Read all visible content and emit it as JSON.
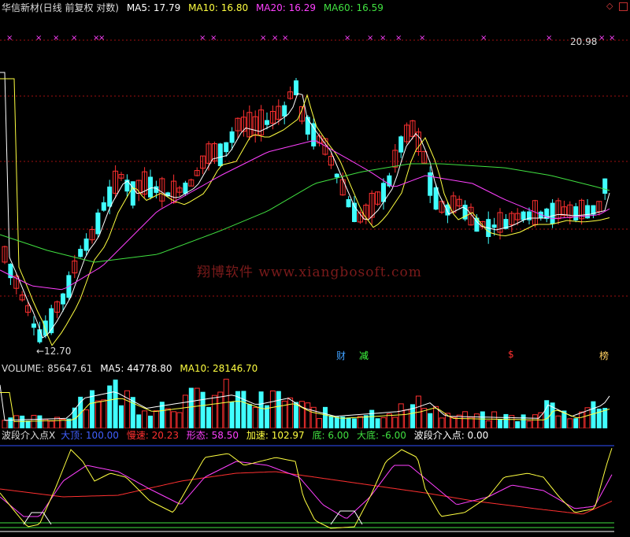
{
  "header": {
    "title": "华信新材(日线 前复权 对数)",
    "ma5": "MA5: 17.79",
    "ma10": "MA10: 16.80",
    "ma20": "MA20: 16.29",
    "ma60": "MA60: 16.59"
  },
  "price_panel": {
    "high_label": "20.98",
    "low_label": "←12.70",
    "watermark": "翔博软件 www.xiangbosoft.com",
    "tags": [
      {
        "text": "财",
        "color": "#40a0ff"
      },
      {
        "text": "减",
        "color": "#40ff40"
      },
      {
        "text": "$",
        "color": "#ff3030"
      },
      {
        "text": "榜",
        "color": "#ffd060"
      }
    ]
  },
  "volume_panel": {
    "label": "VOLUME: 85647.61",
    "ma5": "MA5: 44778.80",
    "ma10": "MA10: 28146.70"
  },
  "indicator_panel": {
    "name": "波段介入点X",
    "dading": "大顶: 100.00",
    "mansu": "慢速: 20.23",
    "xingtai": "形态: 58.50",
    "jiasu": "加速: 102.97",
    "di": "底: 6.00",
    "dadi": "大底: -6.00",
    "jieru": "波段介入点: 0.00"
  },
  "colors": {
    "up": "#ff3030",
    "down": "#40ffff",
    "ma5": "#ffffff",
    "ma10": "#ffff40",
    "ma20": "#ff40ff",
    "ma60": "#40e040",
    "grid": "#a01010"
  },
  "chart_data": {
    "type": "candlestick",
    "title": "华信新材(日线 前复权 对数)",
    "price_labels": {
      "high": 20.98,
      "low": 12.7
    },
    "volume": 85647.61,
    "volume_ma5": 44778.8,
    "volume_ma10": 28146.7,
    "ma": {
      "MA5": 17.79,
      "MA10": 16.8,
      "MA20": 16.29,
      "MA60": 16.59
    },
    "indicator": {
      "大顶": 100.0,
      "慢速": 20.23,
      "形态": 58.5,
      "加速": 102.97,
      "底": 6.0,
      "大底": -6.0,
      "波段介入点": 0.0
    }
  }
}
